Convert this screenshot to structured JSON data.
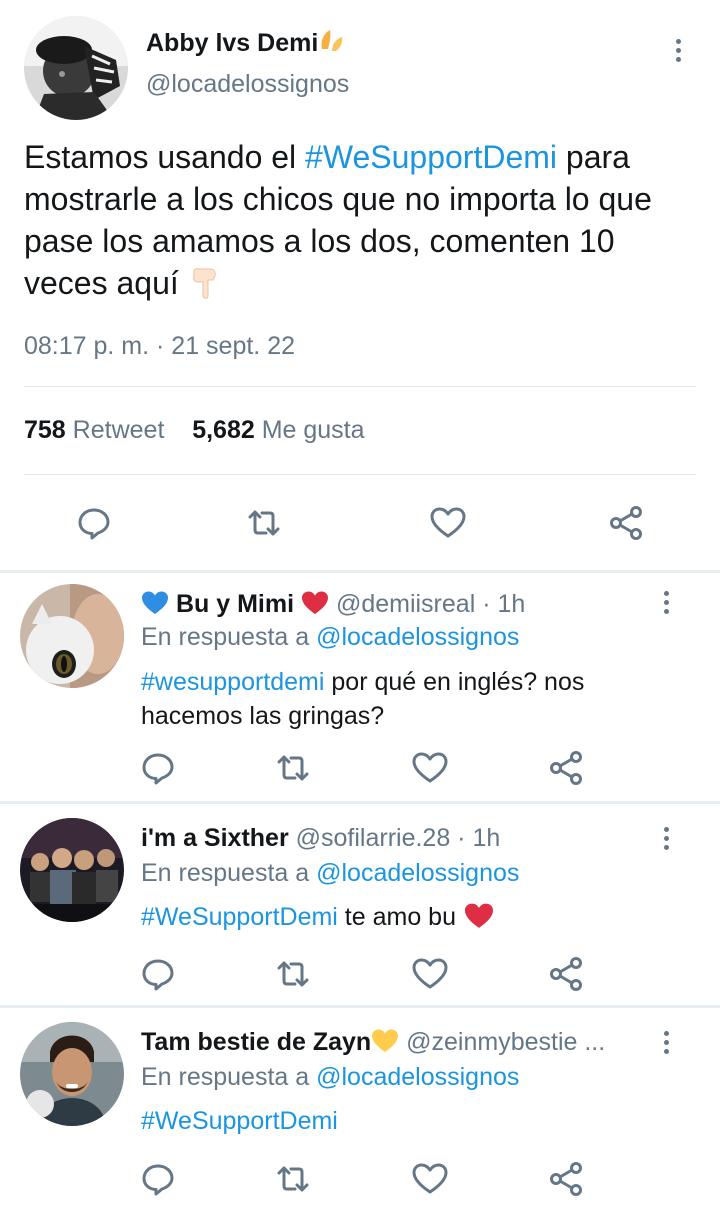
{
  "main_tweet": {
    "name": "Abby lvs Demi",
    "name_emoji": "🙌",
    "handle": "@locadelossignos",
    "text_hashtag": "#WeSupportDemi",
    "text_before": "Estamos usando el ",
    "text_after": " para mostrarle a los chicos que no importa lo que pase los amamos a los dos, comenten 10 veces aquí ",
    "text_emoji": "👇🏻",
    "timestamp": "08:17 p. m. · 21 sept. 22",
    "retweet_count": "758",
    "retweet_label": "Retweet",
    "like_count": "5,682",
    "like_label": "Me gusta"
  },
  "replies": [
    {
      "name_prefix_emoji": "💙",
      "name": "Bu y Mimi",
      "name_suffix_emoji": "❤️",
      "handle": "@demiisreal",
      "sep": " · ",
      "time": "1h",
      "context_label": "En respuesta a ",
      "context_mention": "@locadelossignos",
      "hashtag": "#wesupportdemi",
      "text": " por qué en inglés? nos hacemos las gringas?"
    },
    {
      "name": "i'm a Sixther",
      "handle": "@sofilarrie.28",
      "sep": " · ",
      "time": "1h",
      "context_label": "En respuesta a ",
      "context_mention": "@locadelossignos",
      "hashtag": "#WeSupportDemi",
      "text": " te amo bu ",
      "text_emoji": "❤️"
    },
    {
      "name": "Tam bestie de Zayn",
      "name_suffix_emoji": "💛",
      "handle": "@zeinmybestie ...",
      "context_label": "En respuesta a ",
      "context_mention": "@locadelossignos",
      "hashtag": "#WeSupportDemi"
    }
  ],
  "icons": [
    "reply-icon",
    "retweet-icon",
    "like-icon",
    "share-icon",
    "more-options-icon"
  ],
  "colors": {
    "hashtag": "#1b95e0",
    "secondary_text": "#657786",
    "primary_text": "#14171a",
    "divider": "#e6ecf0"
  }
}
